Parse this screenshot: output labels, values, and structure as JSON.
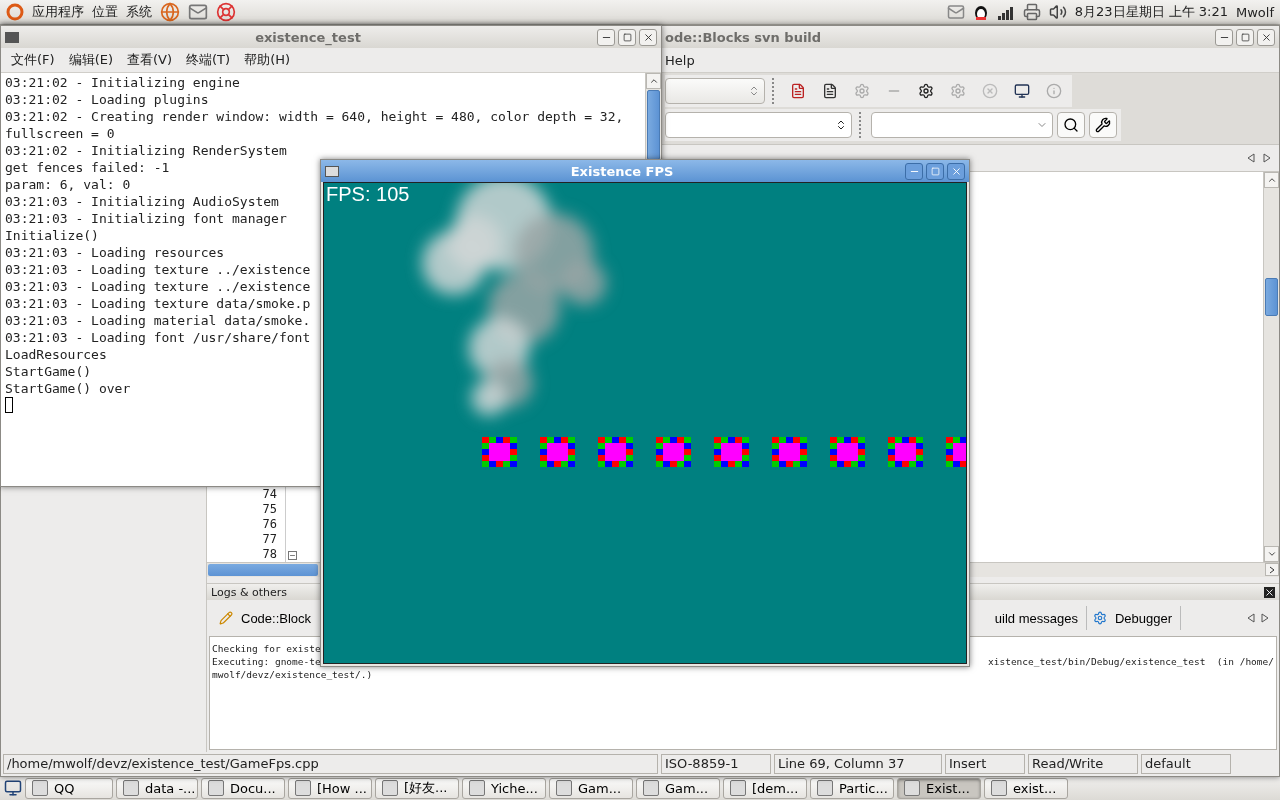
{
  "top_panel": {
    "menus": [
      "应用程序",
      "位置",
      "系统"
    ],
    "clock": "8月23日星期日 上午 3:21",
    "user": "Mwolf"
  },
  "codeblocks_window": {
    "title": "ode::Blocks svn build",
    "menus": [
      "Help"
    ],
    "line_numbers": [
      "74",
      "75",
      "76",
      "77",
      "78"
    ],
    "logs_panel": {
      "title": "Logs & others",
      "tabs_left": [
        "Code::Block"
      ],
      "tabs_right": [
        "uild messages",
        "Debugger"
      ],
      "lines": [
        [
          "Checking for existe"
        ],
        [
          "Executing: gnome-te",
          "xistence_test/bin/Debug/existence_test  (in /home/"
        ],
        [
          "mwolf/devz/existence_test/.)"
        ]
      ]
    },
    "status_bar": [
      "/home/mwolf/devz/existence_test/GameFps.cpp",
      "ISO-8859-1",
      "Line 69, Column 37",
      "Insert",
      "Read/Write",
      "default"
    ]
  },
  "terminal_window": {
    "title": "existence_test",
    "menus": [
      "文件(F)",
      "编辑(E)",
      "查看(V)",
      "终端(T)",
      "帮助(H)"
    ],
    "lines": [
      "03:21:02 - Initializing engine",
      "03:21:02 - Loading plugins",
      "03:21:02 - Creating render window: width = 640, height = 480, color depth = 32,",
      "fullscreen = 0",
      "03:21:02 - Initializing RenderSystem",
      "get fences failed: -1",
      "param: 6, val: 0",
      "03:21:03 - Initializing AudioSystem",
      "03:21:03 - Initializing font manager",
      "Initialize()",
      "03:21:03 - Loading resources",
      "03:21:03 - Loading texture ../existence",
      "03:21:03 - Loading texture ../existence",
      "03:21:03 - Loading texture data/smoke.p",
      "03:21:03 - Loading material data/smoke.",
      "03:21:03 - Loading font /usr/share/font",
      "LoadResources",
      "StartGame()",
      "StartGame() over"
    ]
  },
  "fps_window": {
    "title": "Existence FPS",
    "fps": "FPS: 105"
  },
  "taskbar": [
    {
      "label": "QQ",
      "selected": false
    },
    {
      "label": "data -...",
      "selected": false
    },
    {
      "label": "Docu...",
      "selected": false
    },
    {
      "label": "[How ...",
      "selected": false
    },
    {
      "label": "[好友...",
      "selected": false
    },
    {
      "label": "Yiche...",
      "selected": false
    },
    {
      "label": "Gam...",
      "selected": false
    },
    {
      "label": "Gam...",
      "selected": false
    },
    {
      "label": "[dem...",
      "selected": false
    },
    {
      "label": "Partic...",
      "selected": false
    },
    {
      "label": "Exist...",
      "selected": true
    },
    {
      "label": "exist...",
      "selected": false
    }
  ]
}
